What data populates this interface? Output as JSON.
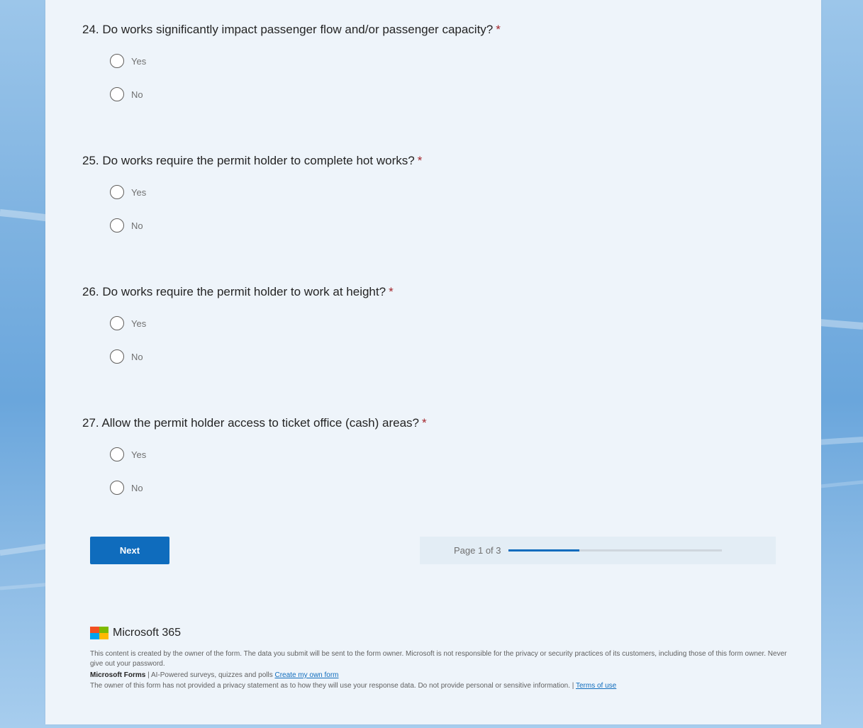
{
  "questions": [
    {
      "number": "24.",
      "text": "Do works significantly impact passenger flow and/or passenger capacity?",
      "required": "*",
      "options": [
        "Yes",
        "No"
      ]
    },
    {
      "number": "25.",
      "text": "Do works require the permit holder to complete hot works?",
      "required": "*",
      "options": [
        "Yes",
        "No"
      ]
    },
    {
      "number": "26.",
      "text": "Do works require the permit holder to work at height?",
      "required": "*",
      "options": [
        "Yes",
        "No"
      ]
    },
    {
      "number": "27.",
      "text": "Allow the permit holder access to ticket office (cash) areas?",
      "required": "*",
      "options": [
        "Yes",
        "No"
      ]
    }
  ],
  "navigation": {
    "next_label": "Next",
    "progress_text": "Page 1 of 3",
    "progress_fraction": 0.333
  },
  "footer": {
    "brand": "Microsoft 365",
    "disclaimer": "This content is created by the owner of the form. The data you submit will be sent to the form owner. Microsoft is not responsible for the privacy or security practices of its customers, including those of this form owner. Never give out your password.",
    "forms_name": "Microsoft Forms",
    "forms_tagline": " | AI-Powered surveys, quizzes and polls ",
    "create_link": "Create my own form",
    "privacy_text": "The owner of this form has not provided a privacy statement as to how they will use your response data. Do not provide personal or sensitive information. | ",
    "terms_link": "Terms of use"
  },
  "colors": {
    "accent": "#0f6cbd",
    "required": "#a4262c",
    "logo": [
      "#f25022",
      "#7fba00",
      "#00a4ef",
      "#ffb900"
    ]
  }
}
